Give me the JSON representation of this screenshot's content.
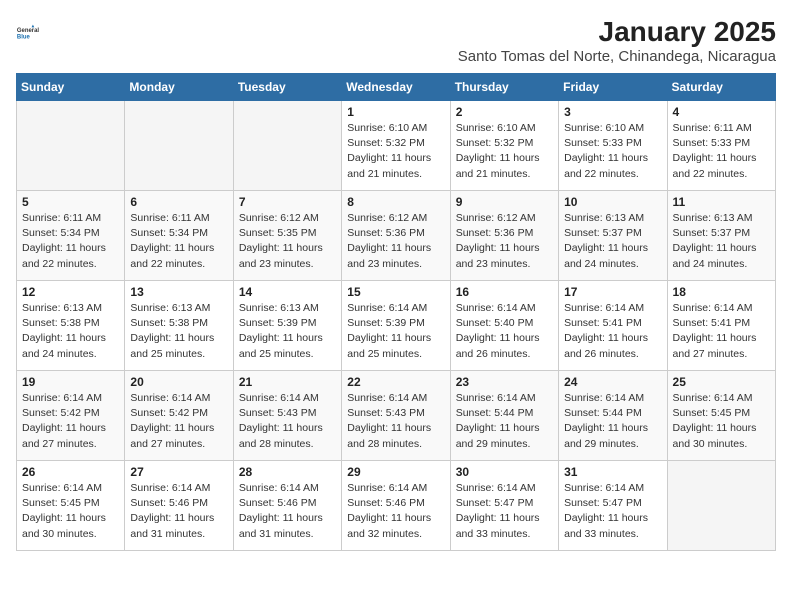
{
  "header": {
    "logo_general": "General",
    "logo_blue": "Blue",
    "title": "January 2025",
    "subtitle": "Santo Tomas del Norte, Chinandega, Nicaragua"
  },
  "calendar": {
    "weekdays": [
      "Sunday",
      "Monday",
      "Tuesday",
      "Wednesday",
      "Thursday",
      "Friday",
      "Saturday"
    ],
    "rows": [
      [
        {
          "day": "",
          "info": ""
        },
        {
          "day": "",
          "info": ""
        },
        {
          "day": "",
          "info": ""
        },
        {
          "day": "1",
          "sunrise": "6:10 AM",
          "sunset": "5:32 PM",
          "daylight": "11 hours and 21 minutes."
        },
        {
          "day": "2",
          "sunrise": "6:10 AM",
          "sunset": "5:32 PM",
          "daylight": "11 hours and 21 minutes."
        },
        {
          "day": "3",
          "sunrise": "6:10 AM",
          "sunset": "5:33 PM",
          "daylight": "11 hours and 22 minutes."
        },
        {
          "day": "4",
          "sunrise": "6:11 AM",
          "sunset": "5:33 PM",
          "daylight": "11 hours and 22 minutes."
        }
      ],
      [
        {
          "day": "5",
          "sunrise": "6:11 AM",
          "sunset": "5:34 PM",
          "daylight": "11 hours and 22 minutes."
        },
        {
          "day": "6",
          "sunrise": "6:11 AM",
          "sunset": "5:34 PM",
          "daylight": "11 hours and 22 minutes."
        },
        {
          "day": "7",
          "sunrise": "6:12 AM",
          "sunset": "5:35 PM",
          "daylight": "11 hours and 23 minutes."
        },
        {
          "day": "8",
          "sunrise": "6:12 AM",
          "sunset": "5:36 PM",
          "daylight": "11 hours and 23 minutes."
        },
        {
          "day": "9",
          "sunrise": "6:12 AM",
          "sunset": "5:36 PM",
          "daylight": "11 hours and 23 minutes."
        },
        {
          "day": "10",
          "sunrise": "6:13 AM",
          "sunset": "5:37 PM",
          "daylight": "11 hours and 24 minutes."
        },
        {
          "day": "11",
          "sunrise": "6:13 AM",
          "sunset": "5:37 PM",
          "daylight": "11 hours and 24 minutes."
        }
      ],
      [
        {
          "day": "12",
          "sunrise": "6:13 AM",
          "sunset": "5:38 PM",
          "daylight": "11 hours and 24 minutes."
        },
        {
          "day": "13",
          "sunrise": "6:13 AM",
          "sunset": "5:38 PM",
          "daylight": "11 hours and 25 minutes."
        },
        {
          "day": "14",
          "sunrise": "6:13 AM",
          "sunset": "5:39 PM",
          "daylight": "11 hours and 25 minutes."
        },
        {
          "day": "15",
          "sunrise": "6:14 AM",
          "sunset": "5:39 PM",
          "daylight": "11 hours and 25 minutes."
        },
        {
          "day": "16",
          "sunrise": "6:14 AM",
          "sunset": "5:40 PM",
          "daylight": "11 hours and 26 minutes."
        },
        {
          "day": "17",
          "sunrise": "6:14 AM",
          "sunset": "5:41 PM",
          "daylight": "11 hours and 26 minutes."
        },
        {
          "day": "18",
          "sunrise": "6:14 AM",
          "sunset": "5:41 PM",
          "daylight": "11 hours and 27 minutes."
        }
      ],
      [
        {
          "day": "19",
          "sunrise": "6:14 AM",
          "sunset": "5:42 PM",
          "daylight": "11 hours and 27 minutes."
        },
        {
          "day": "20",
          "sunrise": "6:14 AM",
          "sunset": "5:42 PM",
          "daylight": "11 hours and 27 minutes."
        },
        {
          "day": "21",
          "sunrise": "6:14 AM",
          "sunset": "5:43 PM",
          "daylight": "11 hours and 28 minutes."
        },
        {
          "day": "22",
          "sunrise": "6:14 AM",
          "sunset": "5:43 PM",
          "daylight": "11 hours and 28 minutes."
        },
        {
          "day": "23",
          "sunrise": "6:14 AM",
          "sunset": "5:44 PM",
          "daylight": "11 hours and 29 minutes."
        },
        {
          "day": "24",
          "sunrise": "6:14 AM",
          "sunset": "5:44 PM",
          "daylight": "11 hours and 29 minutes."
        },
        {
          "day": "25",
          "sunrise": "6:14 AM",
          "sunset": "5:45 PM",
          "daylight": "11 hours and 30 minutes."
        }
      ],
      [
        {
          "day": "26",
          "sunrise": "6:14 AM",
          "sunset": "5:45 PM",
          "daylight": "11 hours and 30 minutes."
        },
        {
          "day": "27",
          "sunrise": "6:14 AM",
          "sunset": "5:46 PM",
          "daylight": "11 hours and 31 minutes."
        },
        {
          "day": "28",
          "sunrise": "6:14 AM",
          "sunset": "5:46 PM",
          "daylight": "11 hours and 31 minutes."
        },
        {
          "day": "29",
          "sunrise": "6:14 AM",
          "sunset": "5:46 PM",
          "daylight": "11 hours and 32 minutes."
        },
        {
          "day": "30",
          "sunrise": "6:14 AM",
          "sunset": "5:47 PM",
          "daylight": "11 hours and 33 minutes."
        },
        {
          "day": "31",
          "sunrise": "6:14 AM",
          "sunset": "5:47 PM",
          "daylight": "11 hours and 33 minutes."
        },
        {
          "day": "",
          "info": ""
        }
      ]
    ]
  }
}
